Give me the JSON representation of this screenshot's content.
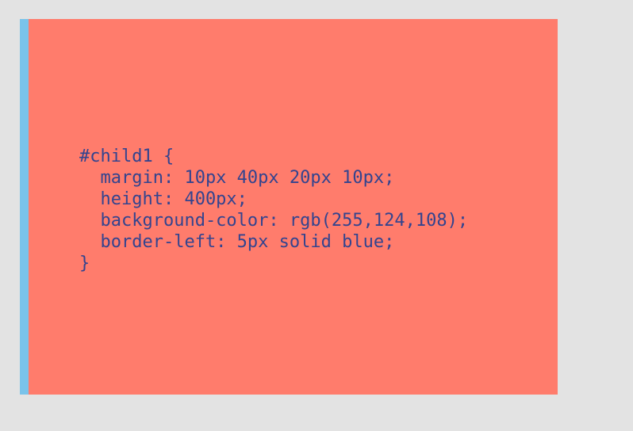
{
  "panel": {
    "background": "#ff7c6c",
    "border_color": "#7ac3ea",
    "code_lines": [
      "#child1 {",
      "  margin: 10px 40px 20px 10px;",
      "  height: 400px;",
      "  background-color: rgb(255,124,108);",
      "  border-left: 5px solid blue;",
      "}"
    ]
  },
  "page": {
    "background": "#e3e3e3",
    "text_color": "#33448f"
  }
}
